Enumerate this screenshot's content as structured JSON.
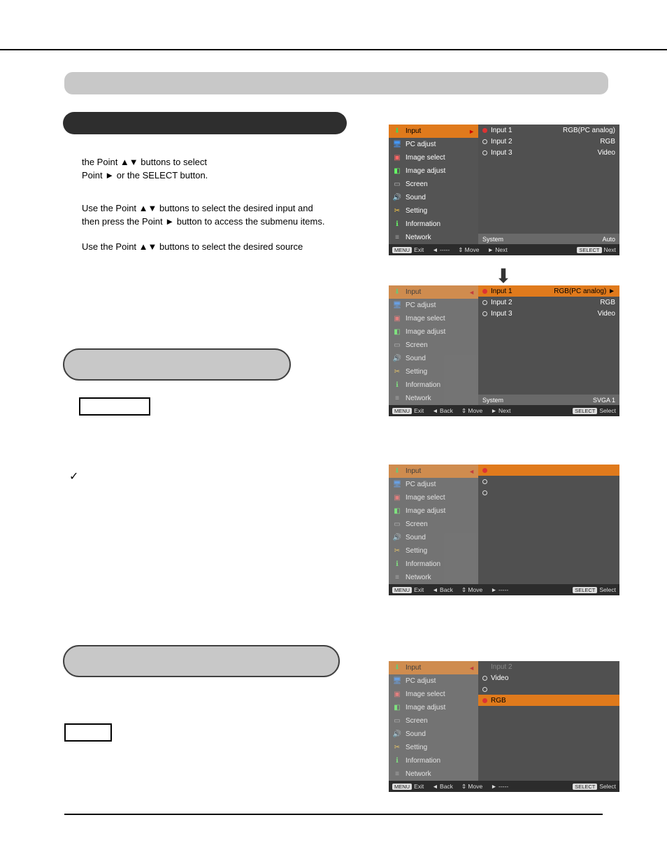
{
  "text": {
    "p1": "the Point ▲▼ buttons to select",
    "p2": "Point ► or the SELECT button.",
    "p3": "Use the Point ▲▼ buttons to select the desired input and",
    "p4": "then press the Point ► button to access the submenu items.",
    "p5": "Use the Point ▲▼ buttons to select the desired source"
  },
  "menu_items": [
    {
      "icon": "ic-input",
      "label": "Input"
    },
    {
      "icon": "ic-pc",
      "label": "PC adjust"
    },
    {
      "icon": "ic-imgsel",
      "label": "Image select"
    },
    {
      "icon": "ic-imgadj",
      "label": "Image adjust"
    },
    {
      "icon": "ic-screen",
      "label": "Screen"
    },
    {
      "icon": "ic-sound",
      "label": "Sound"
    },
    {
      "icon": "ic-set",
      "label": "Setting"
    },
    {
      "icon": "ic-info",
      "label": "Information"
    },
    {
      "icon": "ic-net",
      "label": "Network"
    }
  ],
  "icons": {
    "ic-input": "⬇",
    "ic-pc": "🖥",
    "ic-imgsel": "▣",
    "ic-imgadj": "◧",
    "ic-screen": "▭",
    "ic-sound": "🔊",
    "ic-set": "✂",
    "ic-info": "ℹ",
    "ic-net": "≡"
  },
  "osd1": {
    "right": [
      {
        "sel": true,
        "dot": "fill",
        "label": "Input 1",
        "rlabel": "RGB(PC analog)"
      },
      {
        "sel": false,
        "dot": "",
        "label": "Input 2",
        "rlabel": "RGB"
      },
      {
        "sel": false,
        "dot": "",
        "label": "Input 3",
        "rlabel": "Video"
      }
    ],
    "sysrow": {
      "label": "System",
      "val": "Auto"
    },
    "footer": {
      "exit": "Exit",
      "back": "◄ -----",
      "move": "⇕ Move",
      "next": "► Next",
      "sel": "Next"
    }
  },
  "osd2": {
    "right": [
      {
        "sel": true,
        "dot": "fill",
        "label": "Input 1",
        "rlabel": "RGB(PC analog) ►"
      },
      {
        "sel": false,
        "dot": "",
        "label": "Input 2",
        "rlabel": "RGB"
      },
      {
        "sel": false,
        "dot": "",
        "label": "Input 3",
        "rlabel": "Video"
      }
    ],
    "sysrow": {
      "label": "System",
      "val": "SVGA 1"
    },
    "footer": {
      "exit": "Exit",
      "back": "◄ Back",
      "move": "⇕ Move",
      "next": "► Next",
      "sel": "Select"
    }
  },
  "osd3": {
    "right": [
      {
        "sel": true,
        "dot": "fill",
        "label": "",
        "rlabel": ""
      },
      {
        "sel": false,
        "dot": "",
        "label": "",
        "rlabel": ""
      },
      {
        "sel": false,
        "dot": "",
        "label": "",
        "rlabel": ""
      }
    ],
    "footer": {
      "exit": "Exit",
      "back": "◄ Back",
      "move": "⇕ Move",
      "next": "► -----",
      "sel": "Select"
    }
  },
  "osd4": {
    "right_title": "Input 2",
    "right": [
      {
        "sel": false,
        "dot": "",
        "label": "Video",
        "rlabel": ""
      },
      {
        "sel": false,
        "dot": "",
        "label": "",
        "rlabel": ""
      },
      {
        "sel": true,
        "dot": "fill",
        "label": "RGB",
        "rlabel": ""
      }
    ],
    "footer": {
      "exit": "Exit",
      "back": "◄ Back",
      "move": "⇕ Move",
      "next": "► -----",
      "sel": "Select"
    }
  },
  "footer_keys": {
    "menu": "MENU",
    "sel": "SELECT"
  }
}
